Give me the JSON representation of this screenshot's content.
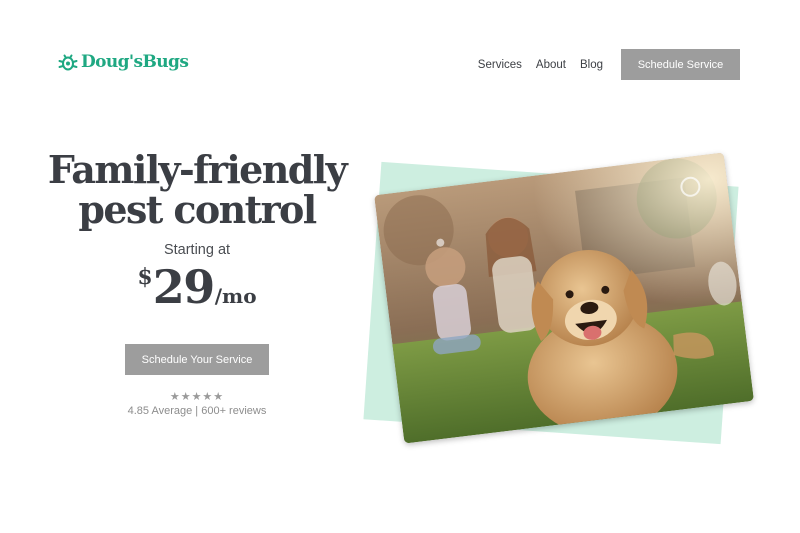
{
  "header": {
    "logo_text": "Doug'sBugs",
    "logo_icon": "bug-icon",
    "nav": [
      "Services",
      "About",
      "Blog"
    ],
    "cta_label": "Schedule Service"
  },
  "hero": {
    "title_line1": "Family-friendly",
    "title_line2": "pest control",
    "starting_text": "Starting at",
    "price_symbol": "$",
    "price_amount": "29",
    "price_unit": "/mo",
    "cta_label": "Schedule Your Service",
    "stars": "★★★★★",
    "rating_text": "4.85 Average | 600+ reviews"
  },
  "image": {
    "subject": "dog-family-photo"
  },
  "colors": {
    "brand": "#1fa882",
    "mint": "#cdeee0",
    "button": "#9d9d9d",
    "heading": "#3b3e44"
  }
}
